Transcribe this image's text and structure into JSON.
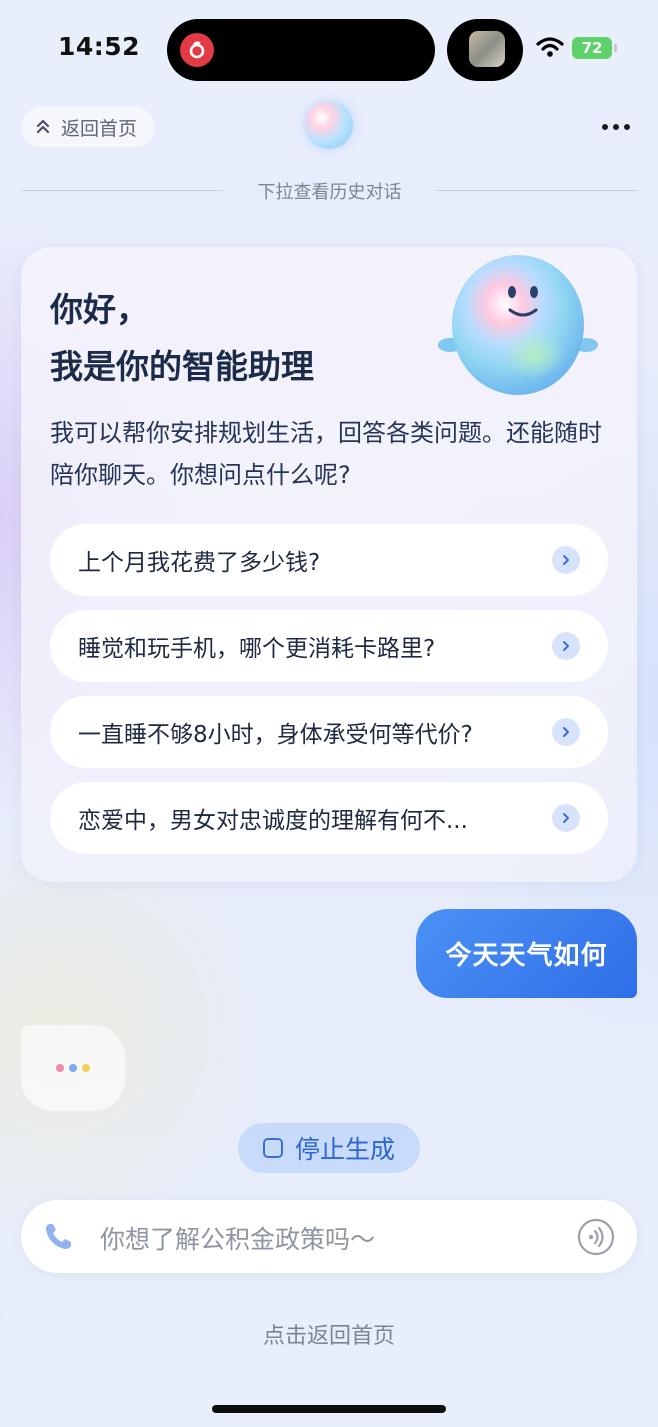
{
  "status_bar": {
    "time": "14:52",
    "battery": "72",
    "island_app_icon": "netease-music-icon",
    "signal_icon": "wifi-icon"
  },
  "header": {
    "back_label": "返回首页",
    "history_hint": "下拉查看历史对话"
  },
  "welcome": {
    "greeting_line1": "你好，",
    "greeting_line2": "我是你的智能助理",
    "intro": "我可以帮你安排规划生活，回答各类问题。还能随时陪你聊天。你想问点什么呢?"
  },
  "suggestions": [
    {
      "label": "上个月我花费了多少钱?"
    },
    {
      "label": "睡觉和玩手机，哪个更消耗卡路里?"
    },
    {
      "label": "一直睡不够8小时，身体承受何等代价?"
    },
    {
      "label": "恋爱中，男女对忠诚度的理解有何不..."
    }
  ],
  "chat": {
    "user_message": "今天天气如何",
    "typing_dot_colors": [
      "#f08bb0",
      "#7fa8f5",
      "#f3cf5a"
    ]
  },
  "controls": {
    "stop_label": "停止生成",
    "input_placeholder": "你想了解公积金政策吗～",
    "back_home_label": "点击返回首页"
  },
  "colors": {
    "accent": "#2f6ee8",
    "chevron_bg": "#d6e3fb",
    "battery_green": "#5fd16a"
  }
}
